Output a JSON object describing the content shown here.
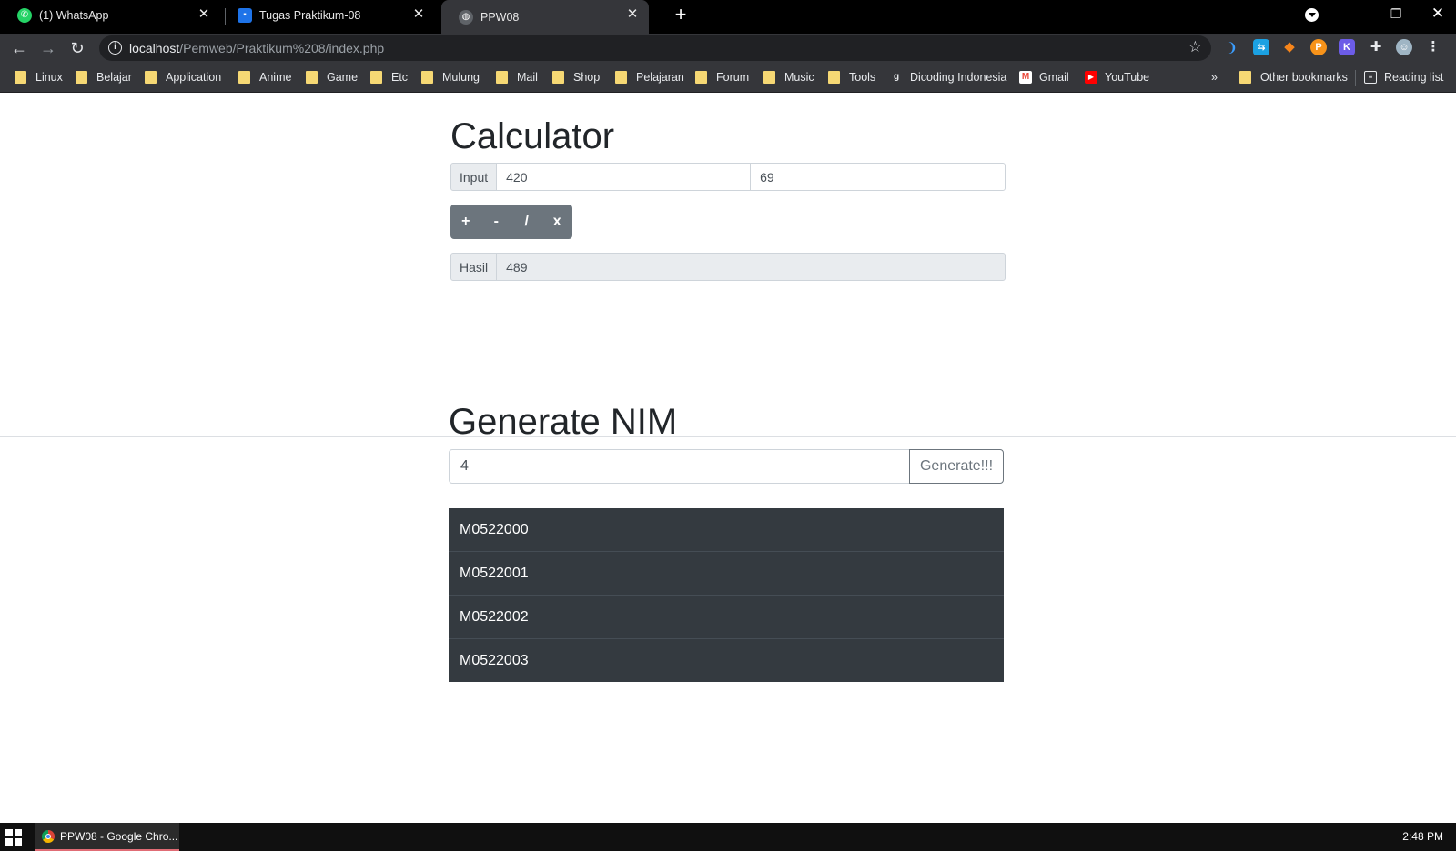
{
  "browser": {
    "tabs": [
      {
        "title": "(1) WhatsApp",
        "icon": "whatsapp-icon",
        "active": false
      },
      {
        "title": "Tugas Praktikum-08",
        "icon": "classroom-icon",
        "active": false
      },
      {
        "title": "PPW08",
        "icon": "globe-icon",
        "active": true
      }
    ],
    "url_host": "localhost",
    "url_path": "/Pemweb/Praktikum%208/index.php",
    "bookmarks": [
      "Linux",
      "Belajar",
      "Application",
      "Anime",
      "Game",
      "Etc",
      "Mulung",
      "Mail",
      "Shop",
      "Pelajaran",
      "Forum",
      "Music",
      "Tools"
    ],
    "bookmark_links": [
      {
        "label": "Dicoding Indonesia",
        "icon": "dicoding-icon"
      },
      {
        "label": "Gmail",
        "icon": "gmail-icon"
      },
      {
        "label": "YouTube",
        "icon": "youtube-icon"
      }
    ],
    "overflow": "»",
    "other_bookmarks": "Other bookmarks",
    "reading_list": "Reading list"
  },
  "calculator": {
    "title": "Calculator",
    "input_label": "Input",
    "input1": "420",
    "input2": "69",
    "ops": [
      "+",
      "-",
      "/",
      "x"
    ],
    "result_label": "Hasil",
    "result": "489"
  },
  "nim": {
    "title": "Generate NIM",
    "count": "4",
    "button": "Generate!!!",
    "results": [
      "M0522000",
      "M0522001",
      "M0522002",
      "M0522003"
    ]
  },
  "taskbar": {
    "item": "PPW08 - Google Chro...",
    "clock": "2:48 PM"
  },
  "colors": {
    "list_bg": "#343a40",
    "btn_secondary": "#6c757d",
    "chrome_dark": "#35363a"
  }
}
